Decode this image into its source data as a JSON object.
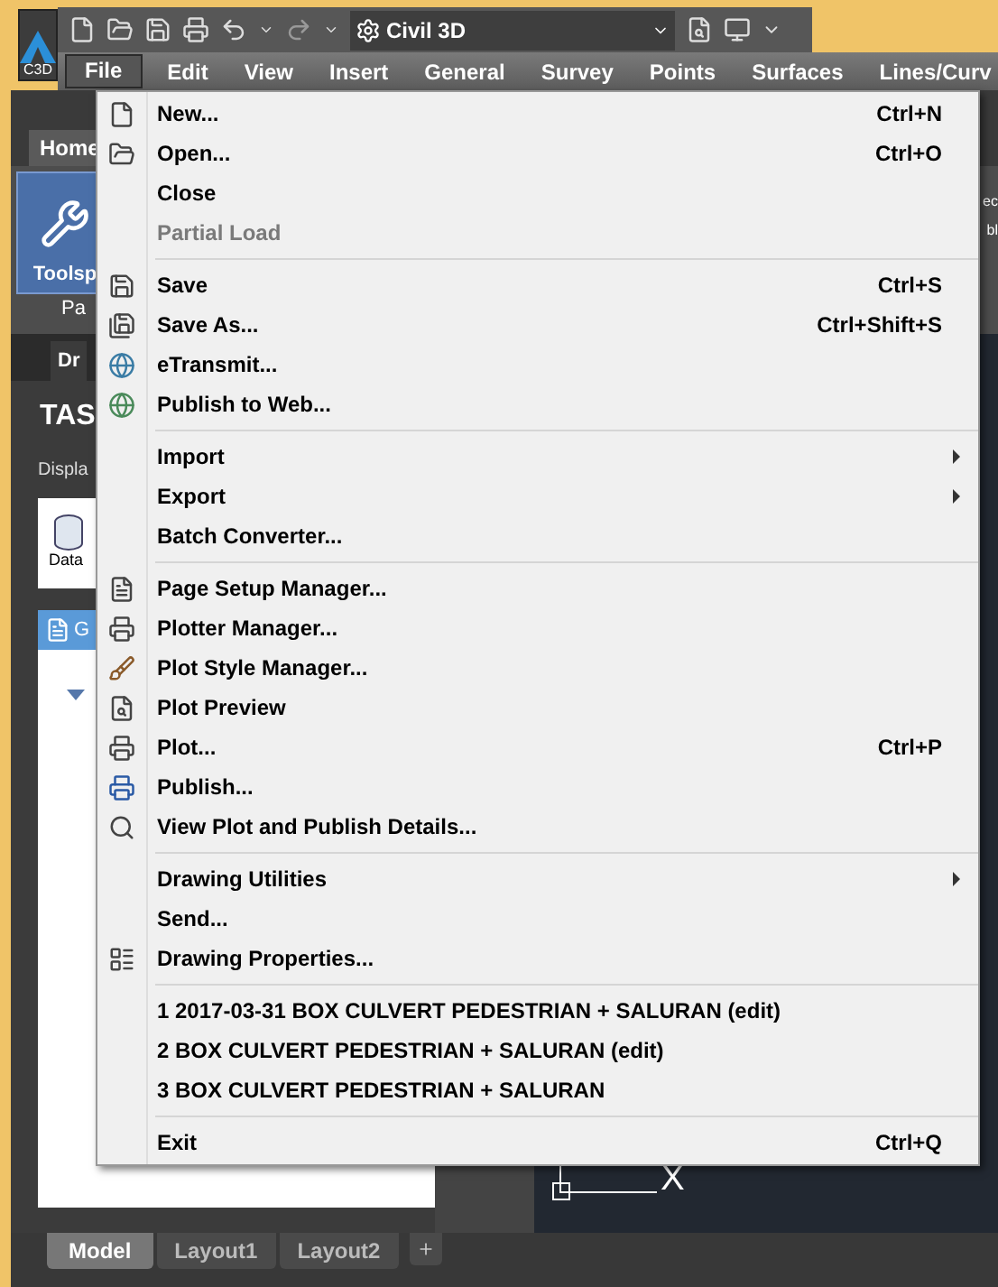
{
  "app_button": {
    "label": "C3D"
  },
  "quick_access": {
    "workspace": "Civil 3D"
  },
  "menubar": [
    {
      "label": "File",
      "selected": true
    },
    {
      "label": "Edit",
      "selected": false
    },
    {
      "label": "View",
      "selected": false
    },
    {
      "label": "Insert",
      "selected": false
    },
    {
      "label": "General",
      "selected": false
    },
    {
      "label": "Survey",
      "selected": false
    },
    {
      "label": "Points",
      "selected": false
    },
    {
      "label": "Surfaces",
      "selected": false
    },
    {
      "label": "Lines/Curv",
      "selected": false
    }
  ],
  "ribbon": {
    "tab": "Home",
    "button": "Toolsp",
    "panel": "Pa",
    "right_labels": [
      "ec",
      "bl"
    ]
  },
  "palette": {
    "tab": "Dr",
    "title": "TAS",
    "subtitle": "Displa",
    "item": "Data",
    "toolbar_label": "G"
  },
  "ucs": {
    "x_label": "X"
  },
  "file_menu": [
    [
      {
        "label": "New...",
        "shortcut": "Ctrl+N",
        "disabled": false,
        "submenu": false
      },
      {
        "label": "Open...",
        "shortcut": "Ctrl+O",
        "disabled": false,
        "submenu": false
      },
      {
        "label": "Close",
        "disabled": false,
        "submenu": false
      },
      {
        "label": "Partial Load",
        "disabled": true,
        "submenu": false
      }
    ],
    [
      {
        "label": "Save",
        "shortcut": "Ctrl+S",
        "disabled": false,
        "submenu": false
      },
      {
        "label": "Save As...",
        "shortcut": "Ctrl+Shift+S",
        "disabled": false,
        "submenu": false
      },
      {
        "label": "eTransmit...",
        "disabled": false,
        "submenu": false
      },
      {
        "label": "Publish to Web...",
        "disabled": false,
        "submenu": false
      }
    ],
    [
      {
        "label": "Import",
        "disabled": false,
        "submenu": true
      },
      {
        "label": "Export",
        "disabled": false,
        "submenu": true
      },
      {
        "label": "Batch Converter...",
        "disabled": false,
        "submenu": false
      }
    ],
    [
      {
        "label": "Page Setup Manager...",
        "disabled": false,
        "submenu": false
      },
      {
        "label": "Plotter Manager...",
        "disabled": false,
        "submenu": false
      },
      {
        "label": "Plot Style Manager...",
        "disabled": false,
        "submenu": false
      },
      {
        "label": "Plot Preview",
        "disabled": false,
        "submenu": false
      },
      {
        "label": "Plot...",
        "shortcut": "Ctrl+P",
        "disabled": false,
        "submenu": false
      },
      {
        "label": "Publish...",
        "disabled": false,
        "submenu": false
      },
      {
        "label": "View Plot and Publish Details...",
        "disabled": false,
        "submenu": false
      }
    ],
    [
      {
        "label": "Drawing Utilities",
        "disabled": false,
        "submenu": true
      },
      {
        "label": "Send...",
        "disabled": false,
        "submenu": false
      },
      {
        "label": "Drawing Properties...",
        "disabled": false,
        "submenu": false
      }
    ],
    [
      {
        "label": "1 2017-03-31 BOX CULVERT PEDESTRIAN + SALURAN (edit)",
        "disabled": false,
        "submenu": false
      },
      {
        "label": "2 BOX CULVERT PEDESTRIAN + SALURAN (edit)",
        "disabled": false,
        "submenu": false
      },
      {
        "label": "3 BOX CULVERT PEDESTRIAN + SALURAN",
        "disabled": false,
        "submenu": false
      }
    ],
    [
      {
        "label": "Exit",
        "shortcut": "Ctrl+Q",
        "disabled": false,
        "submenu": false
      }
    ]
  ],
  "layout_tabs": [
    {
      "label": "Model",
      "selected": true
    },
    {
      "label": "Layout1",
      "selected": false
    },
    {
      "label": "Layout2",
      "selected": false
    }
  ]
}
